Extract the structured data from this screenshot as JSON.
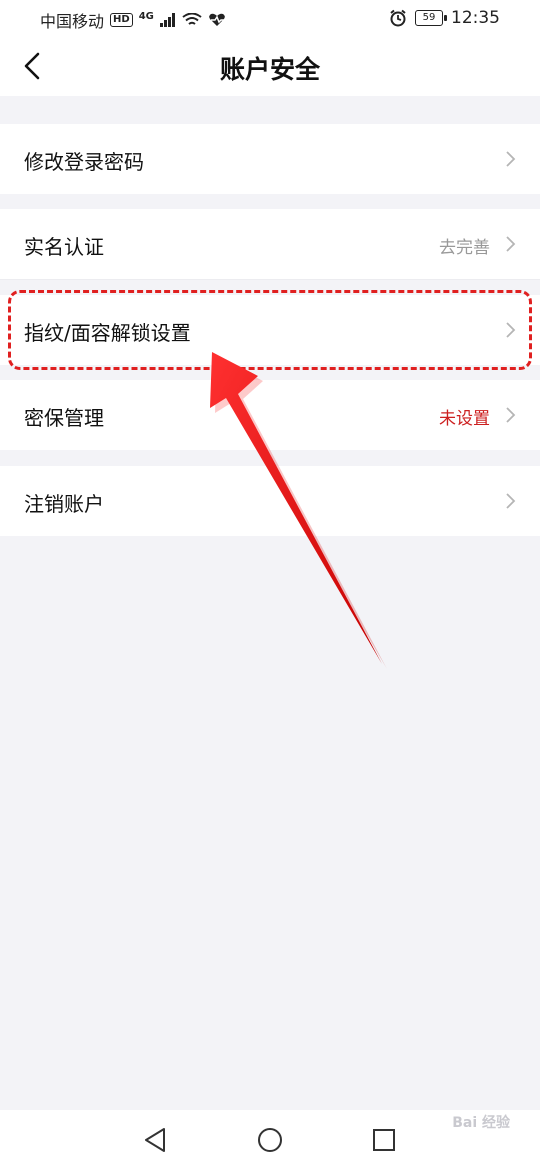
{
  "status_bar": {
    "carrier": "中国移动",
    "hd": "HD",
    "network": "4G",
    "battery": "59",
    "time": "12:35"
  },
  "header": {
    "title": "账户安全"
  },
  "rows": [
    {
      "label": "修改登录密码",
      "value": ""
    },
    {
      "label": "实名认证",
      "value": "去完善"
    },
    {
      "label": "指纹/面容解锁设置",
      "value": ""
    },
    {
      "label": "密保管理",
      "value": "未设置"
    },
    {
      "label": "注销账户",
      "value": ""
    }
  ],
  "colors": {
    "value_gray": "#999999",
    "value_red": "#cc1f1f",
    "highlight_red": "#e02020",
    "background": "#f3f3f7"
  },
  "watermark": {
    "text": "Bai 经验"
  }
}
